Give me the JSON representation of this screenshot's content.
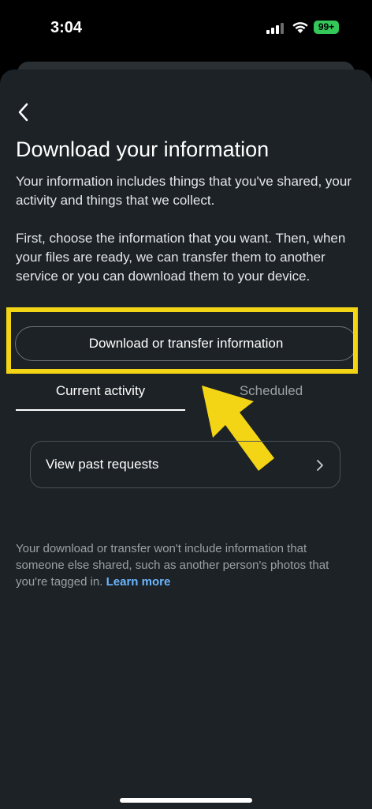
{
  "status": {
    "time": "3:04",
    "battery": "99+"
  },
  "page": {
    "title": "Download your information",
    "intro": "Your information includes things that you've shared, your activity and things that we collect.",
    "instructions": "First, choose the information that you want. Then, when your files are ready, we can transfer them to another service or you can download them to your device.",
    "download_button": "Download or transfer information",
    "tabs": [
      "Current activity",
      "Scheduled"
    ],
    "past_requests": "View past requests",
    "footer": "Your download or transfer won't include information that someone else shared, such as another person's photos that you're tagged in.",
    "learn_more": "Learn more"
  },
  "colors": {
    "highlight": "#f4d516",
    "link": "#6cb5ff",
    "background": "#1c2226"
  },
  "icons": [
    "back-arrow-icon",
    "chevron-right-icon",
    "signal-icon",
    "wifi-icon",
    "battery-icon",
    "arrow-pointer-icon"
  ]
}
